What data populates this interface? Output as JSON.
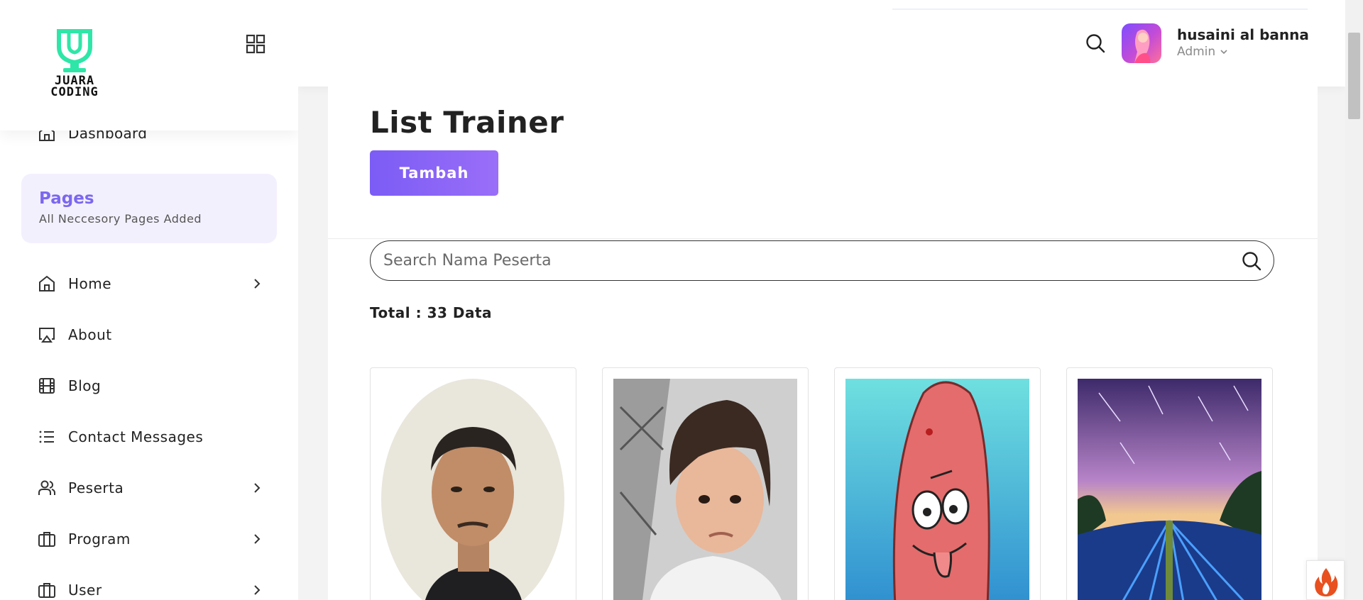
{
  "brand": {
    "logo_text_line1": "JUARA",
    "logo_text_line2": "CODING",
    "accent": "#2ee6a8"
  },
  "sidebar": {
    "dashboard_label": "Dashboard",
    "pages_box": {
      "title": "Pages",
      "subtitle": "All Neccesory Pages Added"
    },
    "items": [
      {
        "label": "Home",
        "icon": "home-icon",
        "has_submenu": true
      },
      {
        "label": "About",
        "icon": "airplay-icon",
        "has_submenu": false
      },
      {
        "label": "Blog",
        "icon": "film-icon",
        "has_submenu": false
      },
      {
        "label": "Contact Messages",
        "icon": "list-icon",
        "has_submenu": false
      },
      {
        "label": "Peserta",
        "icon": "users-icon",
        "has_submenu": true
      },
      {
        "label": "Program",
        "icon": "briefcase-icon",
        "has_submenu": true
      },
      {
        "label": "User",
        "icon": "briefcase-icon",
        "has_submenu": true
      }
    ]
  },
  "header": {
    "user_name": "husaini al banna",
    "user_role": "Admin"
  },
  "main": {
    "title": "List Trainer",
    "add_button_label": "Tambah",
    "search_placeholder": "Search Nama Peserta",
    "total_text": "Total : 33 Data",
    "cards": [
      {
        "photo": "portrait-man"
      },
      {
        "photo": "portrait-long-hair"
      },
      {
        "photo": "cartoon-drawing"
      },
      {
        "photo": "night-sky-field"
      }
    ]
  },
  "colors": {
    "primary": "#7b5cf5",
    "pages_bg": "#f3f0fe",
    "pages_title": "#7b68ee"
  }
}
